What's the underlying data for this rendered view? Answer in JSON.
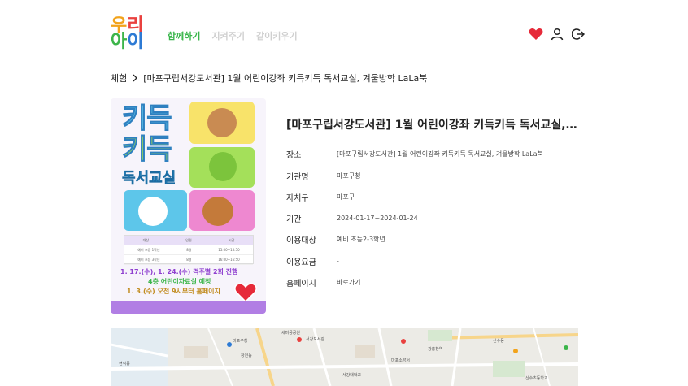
{
  "header": {
    "logo_chars": [
      "우",
      "리",
      "아",
      "이"
    ],
    "nav": [
      {
        "label": "함께하기",
        "active": true
      },
      {
        "label": "지켜주기",
        "active": false
      },
      {
        "label": "같이키우기",
        "active": false
      }
    ],
    "icons": [
      "heart-icon",
      "user-icon",
      "logout-icon"
    ],
    "accent_color": "#38b54a",
    "heart_color": "#e62a39"
  },
  "breadcrumb": {
    "root": "체험",
    "current": "[마포구립서강도서관] 1월 어린이강좌 키득키득 독서교실, 겨울방학 LaLa북"
  },
  "poster": {
    "title_line1": "키득",
    "title_line2": "키득",
    "subtitle": "독서교실",
    "table_header": [
      "대상",
      "인원",
      "시간"
    ],
    "table_rows": [
      [
        "예비 초등 1학년",
        "8명",
        "15:00~15:50"
      ],
      [
        "예비 초등 3학년",
        "8명",
        "16:00~16:50"
      ]
    ],
    "date_line1": "1. 17.(수), 1. 24.(수) 격주별 2회 진행",
    "date_line2": "4층 어린이자료실 예정",
    "date_line3": "1. 3.(수) 오전 9시부터 홈페이지"
  },
  "info": {
    "title": "[마포구립서강도서관] 1월 어린이강좌 키득키득 독서교실, 겨울방학 LaLa북",
    "rows": [
      {
        "label": "장소",
        "value": "[마포구립서강도서관] 1월 어린이강좌 키득키득 독서교실, 겨울방학 LaLa북"
      },
      {
        "label": "기관명",
        "value": "마포구청"
      },
      {
        "label": "자치구",
        "value": "마포구"
      },
      {
        "label": "기간",
        "value": "2024-01-17~2024-01-24"
      },
      {
        "label": "이용대상",
        "value": "예비 초등2-3학년"
      },
      {
        "label": "이용요금",
        "value": "-"
      },
      {
        "label": "홈페이지",
        "value": "바로가기"
      }
    ]
  },
  "map": {
    "labels": [
      "세미공공원",
      "서강도서관",
      "마포구청",
      "창전동",
      "신수동",
      "현석동",
      "광흥창역",
      "서강대학교",
      "신수초등학교",
      "마포소방서"
    ]
  }
}
